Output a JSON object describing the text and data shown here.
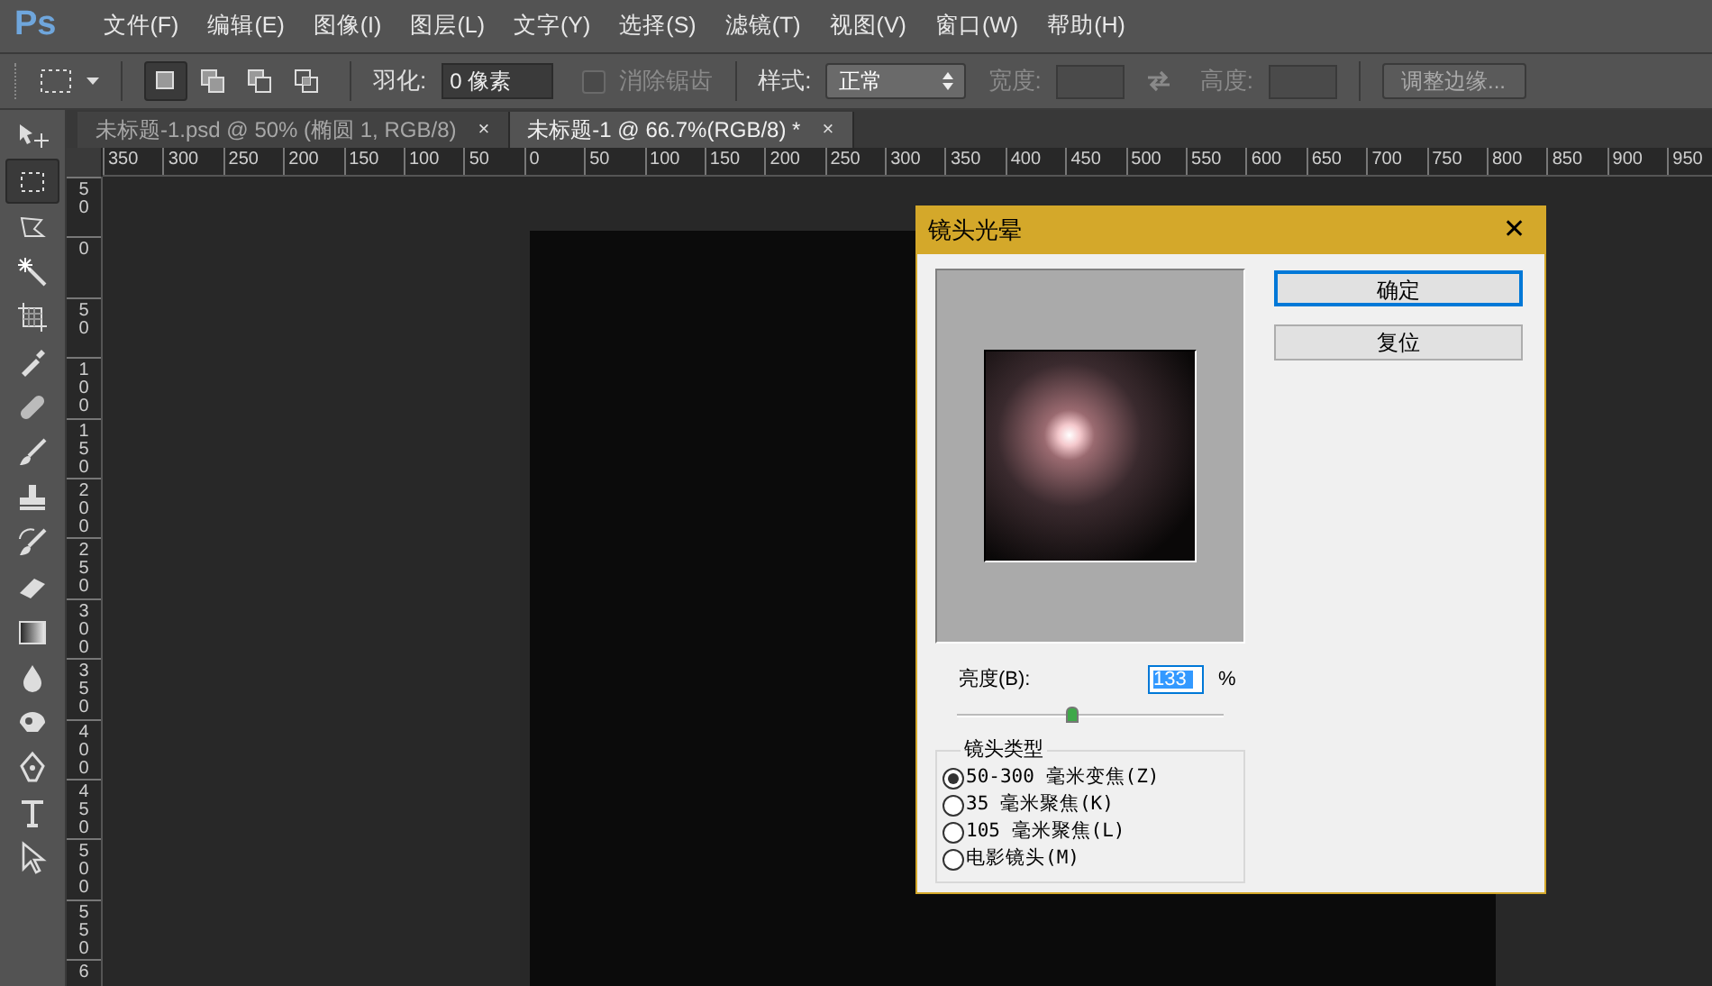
{
  "app": {
    "logo": "Ps"
  },
  "menu": [
    "文件(F)",
    "编辑(E)",
    "图像(I)",
    "图层(L)",
    "文字(Y)",
    "选择(S)",
    "滤镜(T)",
    "视图(V)",
    "窗口(W)",
    "帮助(H)"
  ],
  "options_bar": {
    "modes": [
      {
        "selected": true
      },
      {
        "selected": false
      },
      {
        "selected": false
      },
      {
        "selected": false
      }
    ],
    "feather_label": "羽化:",
    "feather_value": "0 像素",
    "antialias": {
      "label": "消除锯齿",
      "checked": false,
      "disabled": true
    },
    "style_label": "样式:",
    "style_value": "正常",
    "width_label": "宽度:",
    "height_label": "高度:",
    "refine_button": "调整边缘..."
  },
  "tabs": [
    {
      "label": "未标题-1.psd @ 50% (椭圆 1, RGB/8)",
      "close": "×",
      "selected": false
    },
    {
      "label": "未标题-1 @ 66.7%(RGB/8) *",
      "close": "×",
      "selected": true
    }
  ],
  "ruler_h": [
    "350",
    "300",
    "250",
    "200",
    "150",
    "100",
    "50",
    "0",
    "50",
    "100",
    "150",
    "200",
    "250",
    "300",
    "350",
    "400",
    "450",
    "500",
    "550",
    "600",
    "650",
    "700",
    "750",
    "800",
    "850",
    "900",
    "950"
  ],
  "ruler_v": [
    "50",
    "0",
    "50",
    "100",
    "150",
    "200",
    "250",
    "300",
    "350",
    "400",
    "450",
    "500",
    "550",
    "6"
  ],
  "tools": [
    {
      "kind": "move",
      "selected": false
    },
    {
      "kind": "marquee",
      "selected": true
    },
    {
      "kind": "lasso",
      "selected": false
    },
    {
      "kind": "wand",
      "selected": false
    },
    {
      "kind": "crop",
      "selected": false
    },
    {
      "kind": "eyedropper",
      "selected": false
    },
    {
      "kind": "healing",
      "selected": false
    },
    {
      "kind": "brush",
      "selected": false
    },
    {
      "kind": "stamp",
      "selected": false
    },
    {
      "kind": "history",
      "selected": false
    },
    {
      "kind": "eraser",
      "selected": false
    },
    {
      "kind": "gradient",
      "selected": false
    },
    {
      "kind": "blur",
      "selected": false
    },
    {
      "kind": "dodge",
      "selected": false
    },
    {
      "kind": "pen",
      "selected": false
    },
    {
      "kind": "type",
      "selected": false
    },
    {
      "kind": "pointer",
      "selected": false
    }
  ],
  "dialog": {
    "title": "镜头光晕",
    "close": "✕",
    "ok_button": "确定",
    "reset_button": "复位",
    "brightness_label": "亮度(B):",
    "brightness_value": "133",
    "brightness_unit": "%",
    "brightness_slider": {
      "level": 0.43
    },
    "lens_type_label": "镜头类型",
    "lens_types": [
      {
        "label": "50-300 毫米变焦(Z)",
        "selected": true
      },
      {
        "label": "35 毫米聚焦(K)",
        "selected": false
      },
      {
        "label": "105 毫米聚焦(L)",
        "selected": false
      },
      {
        "label": "电影镜头(M)",
        "selected": false
      }
    ]
  }
}
